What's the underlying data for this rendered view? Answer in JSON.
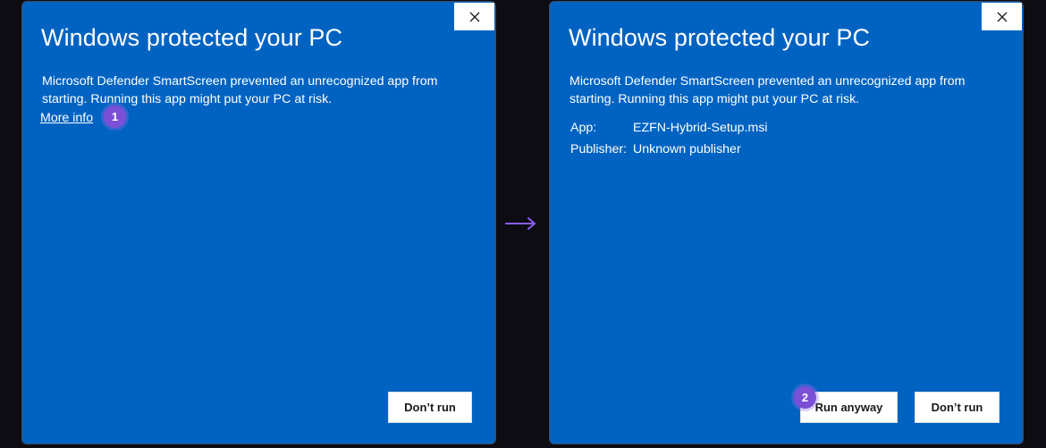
{
  "left_dialog": {
    "title": "Windows protected your PC",
    "message": "Microsoft Defender SmartScreen prevented an unrecognized app from starting. Running this app might put your PC at risk.",
    "more_info_link": "More info",
    "dont_run_label": "Don’t run",
    "step_badge": "1"
  },
  "right_dialog": {
    "title": "Windows protected your PC",
    "message": "Microsoft Defender SmartScreen prevented an unrecognized app from starting. Running this app might put your PC at risk.",
    "details": [
      {
        "label": "App:",
        "value": "EZFN-Hybrid-Setup.msi"
      },
      {
        "label": "Publisher:",
        "value": "Unknown publisher"
      }
    ],
    "run_anyway_label": "Run anyway",
    "dont_run_label": "Don’t run",
    "step_badge": "2"
  },
  "icons": {
    "close": "close-icon",
    "arrow": "arrow-right-icon"
  },
  "colors": {
    "dialog_background": "#0063c1",
    "page_background": "#0c0c12",
    "badge": "#7b4fd6",
    "arrow": "#8a5cf0"
  }
}
